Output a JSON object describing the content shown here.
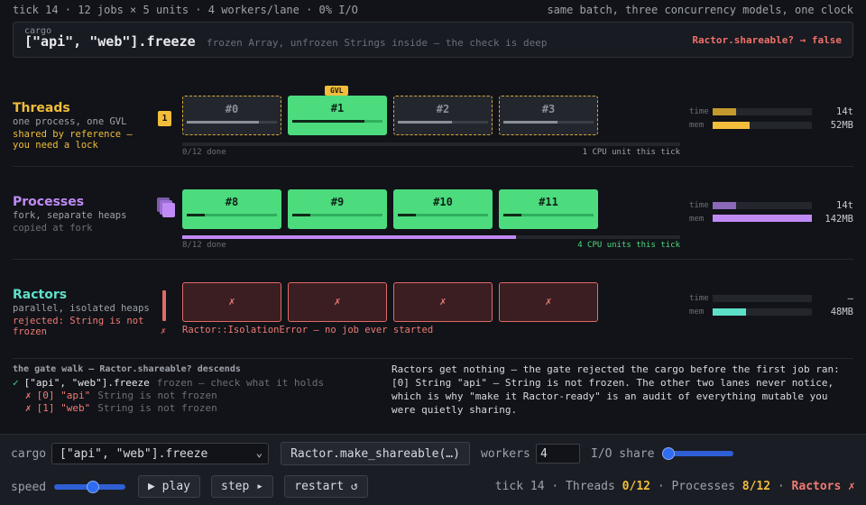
{
  "topbar": {
    "left": "tick 14 · 12 jobs × 5 units · 4 workers/lane · 0% I/O",
    "right": "same batch, three concurrency models, one clock"
  },
  "cargo": {
    "label": "cargo",
    "value": "[\"api\", \"web\"].freeze",
    "note": "frozen Array, unfrozen Strings inside — the check is deep",
    "shareable": "Ractor.shareable? → false"
  },
  "colors": {
    "threads": "#f2bd3b",
    "processes": "#c08af5",
    "ractors": "#5ee0c8",
    "running": "#4cdc7e",
    "error": "#e06a66"
  },
  "threads": {
    "title": "Threads",
    "sub": "one process, one GVL",
    "note": "shared by reference — you need a lock",
    "lock_count": "1",
    "gvl_badge": "GVL",
    "slots": [
      {
        "label": "#0",
        "state": "wait",
        "progress": 0.8
      },
      {
        "label": "#1",
        "state": "run",
        "progress": 0.8
      },
      {
        "label": "#2",
        "state": "wait",
        "progress": 0.6
      },
      {
        "label": "#3",
        "state": "wait",
        "progress": 0.6
      }
    ],
    "overall_progress": 0,
    "done": "0/12 done",
    "cpu": "1 CPU unit this tick",
    "time_label": "time",
    "time_value": "14t",
    "time_fraction": 0.24,
    "mem_label": "mem",
    "mem_value": "52MB",
    "mem_fraction": 0.37
  },
  "processes": {
    "title": "Processes",
    "sub": "fork, separate heaps",
    "note": "copied at fork",
    "slots": [
      {
        "label": "#8",
        "state": "run",
        "progress": 0.2
      },
      {
        "label": "#9",
        "state": "run",
        "progress": 0.2
      },
      {
        "label": "#10",
        "state": "run",
        "progress": 0.2
      },
      {
        "label": "#11",
        "state": "run",
        "progress": 0.2
      }
    ],
    "overall_progress": 0.67,
    "done": "8/12 done",
    "cpu": "4 CPU units this tick",
    "time_label": "time",
    "time_value": "14t",
    "time_fraction": 0.24,
    "mem_label": "mem",
    "mem_value": "142MB",
    "mem_fraction": 1.0
  },
  "ractors": {
    "title": "Ractors",
    "sub": "parallel, isolated heaps",
    "note": "rejected: String is not frozen",
    "gate_mark": "✗",
    "slots": [
      {
        "label": "✗",
        "state": "rej"
      },
      {
        "label": "✗",
        "state": "rej"
      },
      {
        "label": "✗",
        "state": "rej"
      },
      {
        "label": "✗",
        "state": "rej"
      }
    ],
    "error": "Ractor::IsolationError — no job ever started",
    "time_label": "time",
    "time_value": "—",
    "time_fraction": 0,
    "mem_label": "mem",
    "mem_value": "48MB",
    "mem_fraction": 0.34
  },
  "gate": {
    "title": "the gate walk — Ractor.shareable? descends",
    "lines": [
      {
        "mark": "✓",
        "expr": "[\"api\", \"web\"].freeze",
        "note": "frozen — check what it holds",
        "ok": true,
        "indent": 0
      },
      {
        "mark": "✗",
        "expr": "[0] \"api\"",
        "note": "String is not frozen",
        "ok": false,
        "indent": 1
      },
      {
        "mark": "✗",
        "expr": "[1] \"web\"",
        "note": "String is not frozen",
        "ok": false,
        "indent": 1
      }
    ]
  },
  "explanation": "Ractors get nothing — the gate rejected the cargo before the first job ran: [0] String \"api\" — String is not frozen. The other two lanes never notice, which is why \"make it Ractor-ready\" is an audit of everything mutable you were quietly sharing.",
  "controls": {
    "cargo_label": "cargo",
    "cargo_selected": "[\"api\", \"web\"].freeze",
    "make_shareable": "Ractor.make_shareable(…)",
    "workers_label": "workers",
    "workers_value": "4",
    "io_label": "I/O share",
    "io_value": 0,
    "speed_label": "speed",
    "speed_value": 55,
    "play": "▶ play",
    "step": "step ▸",
    "restart": "restart ↺"
  },
  "status": {
    "tick": "tick 14",
    "threads_label": "Threads",
    "threads_value": "0/12",
    "processes_label": "Processes",
    "processes_value": "8/12",
    "ractors_label": "Ractors",
    "ractors_value": "✗",
    "dot": "·"
  }
}
